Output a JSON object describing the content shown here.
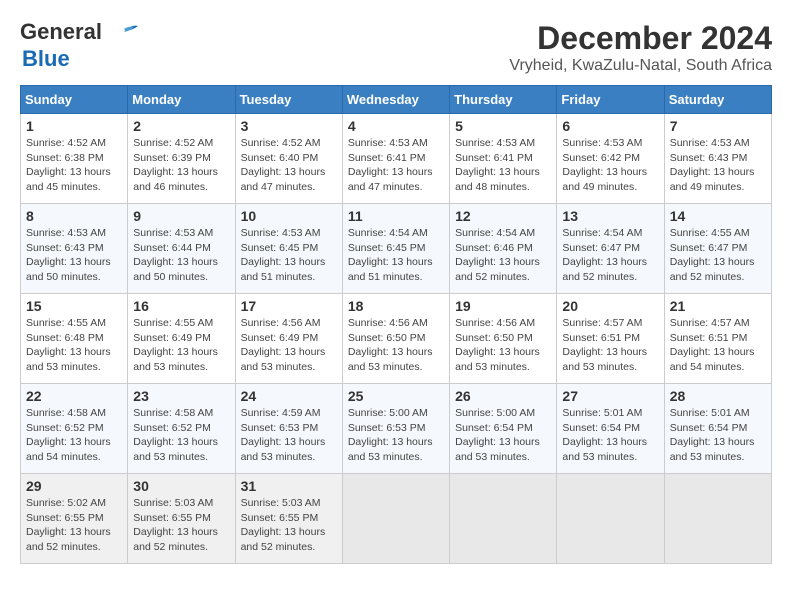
{
  "logo": {
    "line1": "General",
    "line2": "Blue"
  },
  "title": "December 2024",
  "subtitle": "Vryheid, KwaZulu-Natal, South Africa",
  "days_of_week": [
    "Sunday",
    "Monday",
    "Tuesday",
    "Wednesday",
    "Thursday",
    "Friday",
    "Saturday"
  ],
  "weeks": [
    [
      {
        "day": 1,
        "info": "Sunrise: 4:52 AM\nSunset: 6:38 PM\nDaylight: 13 hours\nand 45 minutes."
      },
      {
        "day": 2,
        "info": "Sunrise: 4:52 AM\nSunset: 6:39 PM\nDaylight: 13 hours\nand 46 minutes."
      },
      {
        "day": 3,
        "info": "Sunrise: 4:52 AM\nSunset: 6:40 PM\nDaylight: 13 hours\nand 47 minutes."
      },
      {
        "day": 4,
        "info": "Sunrise: 4:53 AM\nSunset: 6:41 PM\nDaylight: 13 hours\nand 47 minutes."
      },
      {
        "day": 5,
        "info": "Sunrise: 4:53 AM\nSunset: 6:41 PM\nDaylight: 13 hours\nand 48 minutes."
      },
      {
        "day": 6,
        "info": "Sunrise: 4:53 AM\nSunset: 6:42 PM\nDaylight: 13 hours\nand 49 minutes."
      },
      {
        "day": 7,
        "info": "Sunrise: 4:53 AM\nSunset: 6:43 PM\nDaylight: 13 hours\nand 49 minutes."
      }
    ],
    [
      {
        "day": 8,
        "info": "Sunrise: 4:53 AM\nSunset: 6:43 PM\nDaylight: 13 hours\nand 50 minutes."
      },
      {
        "day": 9,
        "info": "Sunrise: 4:53 AM\nSunset: 6:44 PM\nDaylight: 13 hours\nand 50 minutes."
      },
      {
        "day": 10,
        "info": "Sunrise: 4:53 AM\nSunset: 6:45 PM\nDaylight: 13 hours\nand 51 minutes."
      },
      {
        "day": 11,
        "info": "Sunrise: 4:54 AM\nSunset: 6:45 PM\nDaylight: 13 hours\nand 51 minutes."
      },
      {
        "day": 12,
        "info": "Sunrise: 4:54 AM\nSunset: 6:46 PM\nDaylight: 13 hours\nand 52 minutes."
      },
      {
        "day": 13,
        "info": "Sunrise: 4:54 AM\nSunset: 6:47 PM\nDaylight: 13 hours\nand 52 minutes."
      },
      {
        "day": 14,
        "info": "Sunrise: 4:55 AM\nSunset: 6:47 PM\nDaylight: 13 hours\nand 52 minutes."
      }
    ],
    [
      {
        "day": 15,
        "info": "Sunrise: 4:55 AM\nSunset: 6:48 PM\nDaylight: 13 hours\nand 53 minutes."
      },
      {
        "day": 16,
        "info": "Sunrise: 4:55 AM\nSunset: 6:49 PM\nDaylight: 13 hours\nand 53 minutes."
      },
      {
        "day": 17,
        "info": "Sunrise: 4:56 AM\nSunset: 6:49 PM\nDaylight: 13 hours\nand 53 minutes."
      },
      {
        "day": 18,
        "info": "Sunrise: 4:56 AM\nSunset: 6:50 PM\nDaylight: 13 hours\nand 53 minutes."
      },
      {
        "day": 19,
        "info": "Sunrise: 4:56 AM\nSunset: 6:50 PM\nDaylight: 13 hours\nand 53 minutes."
      },
      {
        "day": 20,
        "info": "Sunrise: 4:57 AM\nSunset: 6:51 PM\nDaylight: 13 hours\nand 53 minutes."
      },
      {
        "day": 21,
        "info": "Sunrise: 4:57 AM\nSunset: 6:51 PM\nDaylight: 13 hours\nand 54 minutes."
      }
    ],
    [
      {
        "day": 22,
        "info": "Sunrise: 4:58 AM\nSunset: 6:52 PM\nDaylight: 13 hours\nand 54 minutes."
      },
      {
        "day": 23,
        "info": "Sunrise: 4:58 AM\nSunset: 6:52 PM\nDaylight: 13 hours\nand 53 minutes."
      },
      {
        "day": 24,
        "info": "Sunrise: 4:59 AM\nSunset: 6:53 PM\nDaylight: 13 hours\nand 53 minutes."
      },
      {
        "day": 25,
        "info": "Sunrise: 5:00 AM\nSunset: 6:53 PM\nDaylight: 13 hours\nand 53 minutes."
      },
      {
        "day": 26,
        "info": "Sunrise: 5:00 AM\nSunset: 6:54 PM\nDaylight: 13 hours\nand 53 minutes."
      },
      {
        "day": 27,
        "info": "Sunrise: 5:01 AM\nSunset: 6:54 PM\nDaylight: 13 hours\nand 53 minutes."
      },
      {
        "day": 28,
        "info": "Sunrise: 5:01 AM\nSunset: 6:54 PM\nDaylight: 13 hours\nand 53 minutes."
      }
    ],
    [
      {
        "day": 29,
        "info": "Sunrise: 5:02 AM\nSunset: 6:55 PM\nDaylight: 13 hours\nand 52 minutes."
      },
      {
        "day": 30,
        "info": "Sunrise: 5:03 AM\nSunset: 6:55 PM\nDaylight: 13 hours\nand 52 minutes."
      },
      {
        "day": 31,
        "info": "Sunrise: 5:03 AM\nSunset: 6:55 PM\nDaylight: 13 hours\nand 52 minutes."
      },
      null,
      null,
      null,
      null
    ]
  ]
}
